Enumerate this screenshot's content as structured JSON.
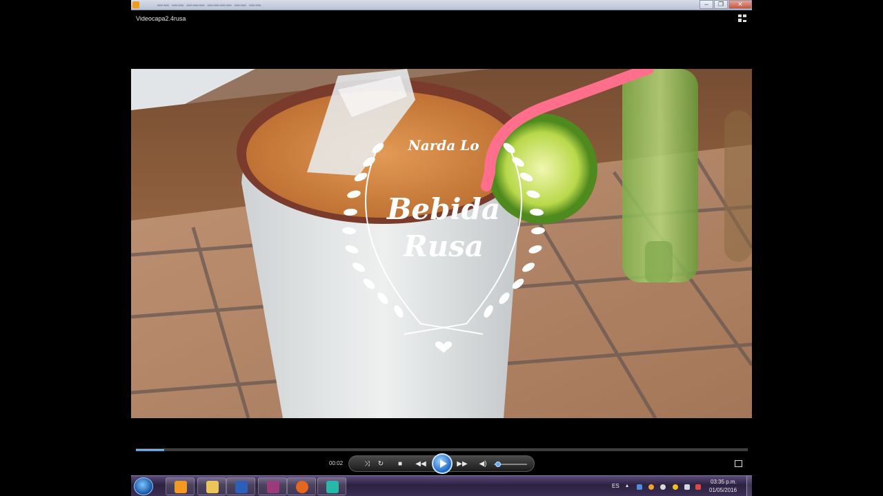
{
  "window": {
    "title": "Videocapa2.4rusa"
  },
  "video_overlay": {
    "author": "Narda Lo",
    "line1": "Bebida",
    "line2": "Rusa"
  },
  "playback": {
    "time": "00:02",
    "progress_fraction": 0.046,
    "volume_fraction": 0.05
  },
  "taskbar": {
    "language": "ES",
    "clock_time": "03:35 p.m.",
    "clock_date": "01/05/2016",
    "pinned": [
      "media-player-icon",
      "file-explorer-icon",
      "word-icon",
      "winrar-icon",
      "firefox-icon",
      "filmora-icon"
    ]
  },
  "colors": {
    "accent": "#3f86d6",
    "taskbar": "#2c2240"
  }
}
